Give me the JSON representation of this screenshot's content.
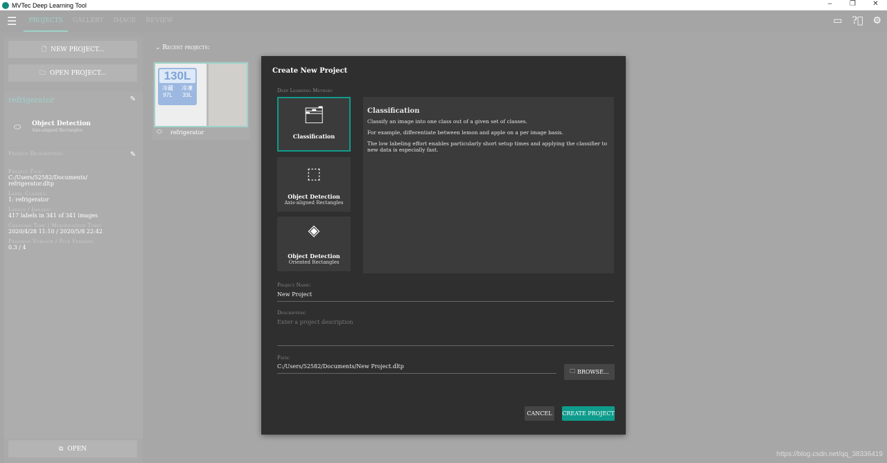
{
  "window": {
    "title": "MVTec Deep Learning Tool",
    "minimize": "–",
    "restore": "❐",
    "close": "✕"
  },
  "nav": {
    "tabs": [
      "PROJECTS",
      "GALLERY",
      "IMAGE",
      "REVIEW"
    ]
  },
  "sidebar": {
    "new_project": "NEW PROJECT...",
    "open_project": "OPEN PROJECT...",
    "project_name": "refrigerator",
    "method_title": "Object Detection",
    "method_sub": "Axis-aligned Rectangles",
    "desc_label": "Project Description:",
    "file_label": "Project File:",
    "file_value": "C:/Users/52582/Documents/ refrigerator.dltp",
    "classes_label": "Label Classes:",
    "classes_value": "1: refrigerator",
    "labels_label": "Labels / Images:",
    "labels_value": "417 labels in 341 of 341 images",
    "time_label": "Creation Time / Modification Time:",
    "time_value": "2020/4/28 11:10 / 2020/5/8 22:42",
    "version_label": "Program Version / File Version:",
    "version_value": "0.3 / 4",
    "open": "OPEN"
  },
  "recent": {
    "label": "Recent projects:",
    "items": [
      {
        "name": "refrigerator",
        "thumb_big": "130L",
        "thumb_a": "冷藏",
        "thumb_a2": "97L",
        "thumb_b": "冷凍",
        "thumb_b2": "33L"
      }
    ]
  },
  "dialog": {
    "title": "Create New Project",
    "method_label": "Deep Learning Method:",
    "methods": [
      {
        "title": "Classification",
        "sub": ""
      },
      {
        "title": "Object Detection",
        "sub": "Axis-aligned Rectangles"
      },
      {
        "title": "Object Detection",
        "sub": "Oriented Rectangles"
      }
    ],
    "desc_title": "Classification",
    "desc_p1": "Classify an image into one class out of a given set of classes.",
    "desc_p2": "For example, differentiate between lemon and apple on a per image basis.",
    "desc_p3": "The low labeling effort enables particularly short setup times and applying the classifier to new data is especially fast.",
    "name_label": "Project Name:",
    "name_value": "New Project",
    "description_label": "Description:",
    "description_placeholder": "Enter a project description",
    "path_label": "Path:",
    "path_value": "C:/Users/52582/Documents/New Project.dltp",
    "browse": "BROWSE...",
    "cancel": "CANCEL",
    "create": "CREATE PROJECT"
  },
  "watermark": "https://blog.csdn.net/qq_38336419",
  "colors": {
    "accent": "#0f9c8c",
    "dialog": "#2f2f2f"
  }
}
